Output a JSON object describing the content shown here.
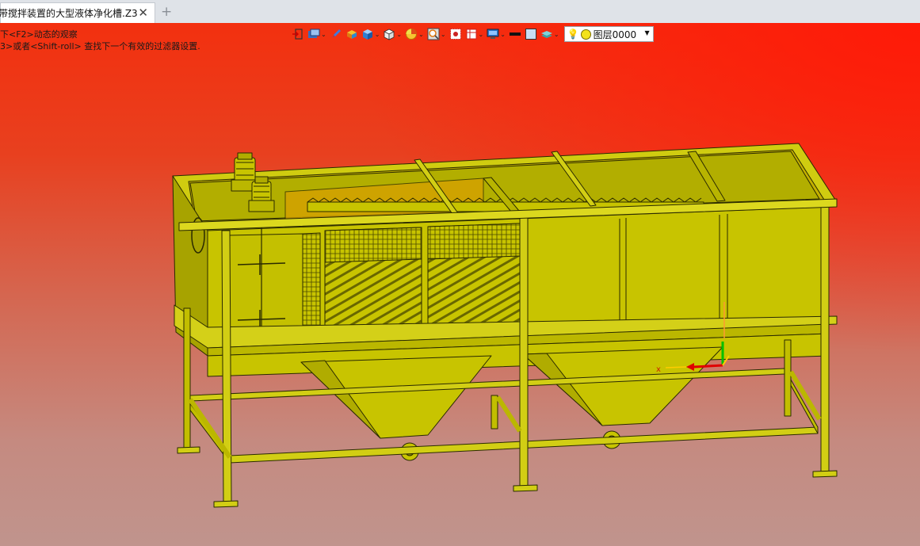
{
  "tab": {
    "title": "带搅拌装置的大型液体净化槽.Z3",
    "close_glyph": "✕",
    "add_glyph": "+"
  },
  "viewport": {
    "hint_line1": "下<F2>动态的观察",
    "hint_line2": "3>或者<Shift-roll> 查找下一个有效的过滤器设置."
  },
  "toolbar": {
    "items": [
      {
        "icon": "exit-sketch-icon"
      },
      {
        "icon": "view-orientation-icon"
      },
      {
        "icon": "pen-icon"
      },
      {
        "icon": "render-mode-icon"
      },
      {
        "icon": "solid-cube-icon"
      },
      {
        "icon": "wire-cube-icon"
      },
      {
        "icon": "section-view-icon"
      },
      {
        "icon": "zoom-icon"
      },
      {
        "icon": "selection-filter-icon"
      },
      {
        "icon": "grid-icon"
      },
      {
        "icon": "display-icon"
      },
      {
        "icon": "line-color-icon"
      },
      {
        "icon": "fill-color-icon"
      },
      {
        "icon": "layer-stack-icon"
      }
    ],
    "layer": {
      "label": "图层0000",
      "caret": "▼"
    }
  },
  "colors": {
    "model_face": "#c8c400",
    "model_face_light": "#d9d62a",
    "model_face_dark": "#a7a300",
    "model_edge": "#2a2a00",
    "axis_x": "#e00000",
    "axis_y": "#00c000",
    "axis_z": "#ffcc00"
  }
}
